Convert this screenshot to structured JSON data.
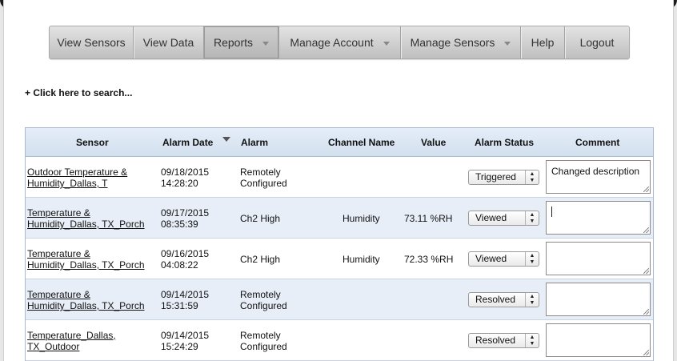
{
  "nav": {
    "items": [
      {
        "label": "View Sensors",
        "dropdown": false,
        "active": false
      },
      {
        "label": "View Data",
        "dropdown": false,
        "active": false
      },
      {
        "label": "Reports",
        "dropdown": true,
        "active": true
      },
      {
        "label": "Manage Account",
        "dropdown": true,
        "active": false
      },
      {
        "label": "Manage Sensors",
        "dropdown": true,
        "active": false
      },
      {
        "label": "Help",
        "dropdown": false,
        "active": false
      },
      {
        "label": "Logout",
        "dropdown": false,
        "active": false
      }
    ]
  },
  "search": {
    "label": "+ Click here to search..."
  },
  "table": {
    "headers": {
      "sensor": "Sensor",
      "alarm_date": "Alarm Date",
      "alarm": "Alarm",
      "channel_name": "Channel Name",
      "value": "Value",
      "alarm_status": "Alarm Status",
      "comment": "Comment"
    },
    "sort_icon": "sort-desc-icon",
    "rows": [
      {
        "sensor_1": "Outdoor Temperature &",
        "sensor_2": "Humidity_Dallas, T",
        "date": "09/18/2015",
        "time": "14:28:20",
        "alarm_1": "Remotely",
        "alarm_2": "Configured",
        "channel": "",
        "value": "",
        "status": "Triggered",
        "comment": "Changed description"
      },
      {
        "sensor_1": "Temperature &",
        "sensor_2": "Humidity_Dallas, TX_Porch",
        "date": "09/17/2015",
        "time": "08:35:39",
        "alarm_1": "Ch2 High",
        "alarm_2": "",
        "channel": "Humidity",
        "value": "73.11 %RH",
        "status": "Viewed",
        "comment": ""
      },
      {
        "sensor_1": "Temperature &",
        "sensor_2": "Humidity_Dallas, TX_Porch",
        "date": "09/16/2015",
        "time": "04:08:22",
        "alarm_1": "Ch2 High",
        "alarm_2": "",
        "channel": "Humidity",
        "value": "72.33 %RH",
        "status": "Viewed",
        "comment": ""
      },
      {
        "sensor_1": "Temperature &",
        "sensor_2": "Humidity_Dallas, TX_Porch",
        "date": "09/14/2015",
        "time": "15:31:59",
        "alarm_1": "Remotely",
        "alarm_2": "Configured",
        "channel": "",
        "value": "",
        "status": "Resolved",
        "comment": ""
      },
      {
        "sensor_1": "Temperature_Dallas,",
        "sensor_2": "TX_Outdoor",
        "date": "09/14/2015",
        "time": "15:24:29",
        "alarm_1": "Remotely",
        "alarm_2": "Configured",
        "channel": "",
        "value": "",
        "status": "Resolved",
        "comment": ""
      }
    ]
  }
}
